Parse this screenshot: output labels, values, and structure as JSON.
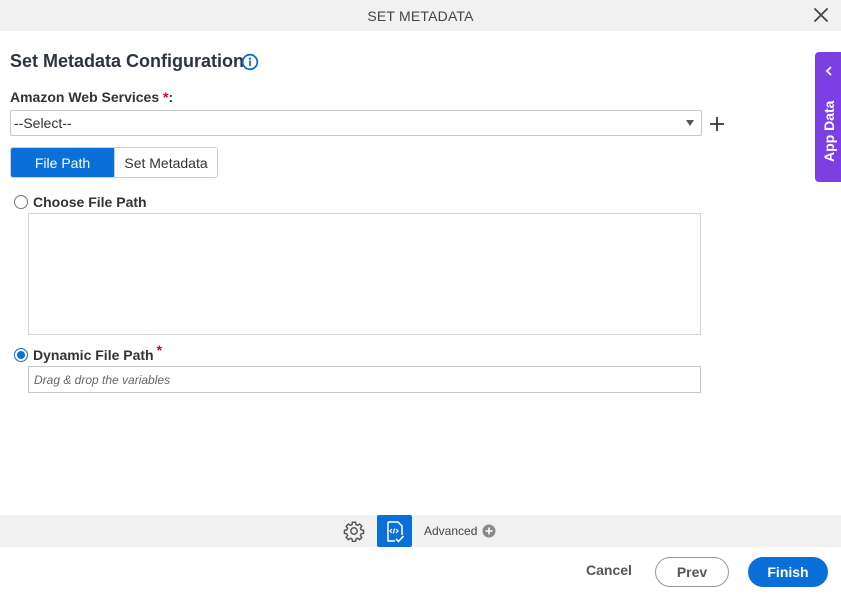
{
  "window": {
    "title": "SET METADATA"
  },
  "page": {
    "title": "Set Metadata Configuration"
  },
  "aws": {
    "label": "Amazon Web Services",
    "required_mark": "*",
    "label_suffix": ":",
    "selected": "--Select--"
  },
  "tabs": [
    {
      "label": "File Path",
      "active": true
    },
    {
      "label": "Set Metadata",
      "active": false
    }
  ],
  "file_path": {
    "choose_label": "Choose File Path",
    "choose_checked": false,
    "dynamic_label": "Dynamic File Path",
    "dynamic_required_mark": "*",
    "dynamic_checked": true,
    "dynamic_placeholder": "Drag & drop the variables"
  },
  "side_panel": {
    "label": "App Data"
  },
  "toolbar": {
    "advanced_label": "Advanced"
  },
  "footer": {
    "cancel": "Cancel",
    "prev": "Prev",
    "finish": "Finish"
  },
  "colors": {
    "primary": "#0a6fd8",
    "app_data": "#7b3fe4",
    "required": "#d0021b"
  },
  "icons": [
    "close-icon",
    "info-icon",
    "plus-icon",
    "chevron-left-icon",
    "gear-icon",
    "code-check-icon",
    "plus-circle-icon"
  ]
}
